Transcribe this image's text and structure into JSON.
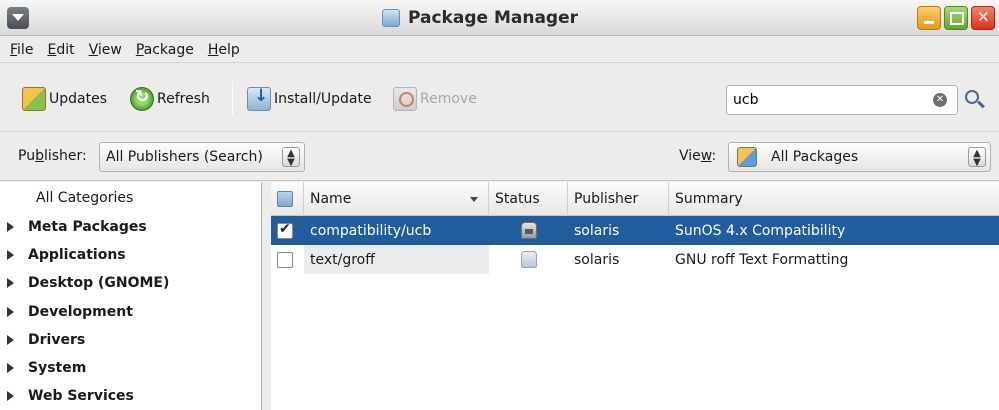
{
  "window": {
    "title": "Package Manager"
  },
  "menubar": {
    "items": [
      {
        "mnemonic": "F",
        "rest": "ile"
      },
      {
        "mnemonic": "E",
        "rest": "dit"
      },
      {
        "mnemonic": "V",
        "rest": "iew"
      },
      {
        "mnemonic": "P",
        "rest": "ackage"
      },
      {
        "mnemonic": "H",
        "rest": "elp"
      }
    ]
  },
  "toolbar": {
    "updates_label": "Updates",
    "refresh_label": "Refresh",
    "install_label": "Install/Update",
    "remove_label": "Remove",
    "search_value": "ucb"
  },
  "filterbar": {
    "publisher_label_a": "Pu",
    "publisher_label_mn": "b",
    "publisher_label_b": "lisher:",
    "publisher_value": "All Publishers (Search)",
    "view_label_a": "Vie",
    "view_label_mn": "w",
    "view_label_b": ":",
    "view_value": "All Packages"
  },
  "sidebar": {
    "all_categories": "All Categories",
    "categories": [
      "Meta Packages",
      "Applications",
      "Desktop (GNOME)",
      "Development",
      "Drivers",
      "System",
      "Web Services"
    ]
  },
  "table": {
    "columns": [
      "Name",
      "Status",
      "Publisher",
      "Summary"
    ],
    "rows": [
      {
        "name": "compatibility/ucb",
        "status": "installed",
        "publisher": "solaris",
        "summary": "SunOS 4.x Compatibility",
        "checked": true
      },
      {
        "name": "text/groff",
        "status": "not-installed",
        "publisher": "solaris",
        "summary": "GNU roff Text Formatting",
        "checked": false
      }
    ]
  }
}
